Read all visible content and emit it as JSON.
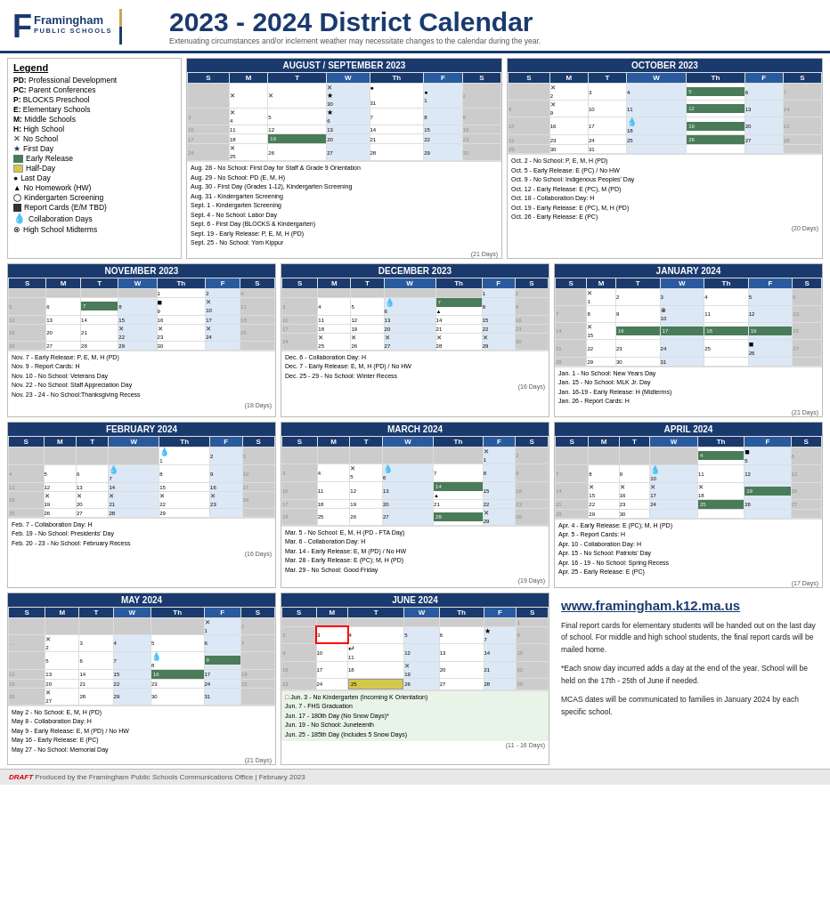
{
  "header": {
    "title": "2023 - 2024 District Calendar",
    "subtitle": "Extenuating circumstances and/or inclement weather may necessitate changes to the calendar during the year.",
    "logo_name": "Framingham",
    "logo_sub": "PUBLIC SCHOOLS"
  },
  "legend": {
    "title": "Legend",
    "items": [
      {
        "symbol": "PD:",
        "text": "Professional Development"
      },
      {
        "symbol": "PC:",
        "text": "Parent Conferences"
      },
      {
        "symbol": "P:",
        "text": "BLOCKS Preschool"
      },
      {
        "symbol": "E:",
        "text": "Elementary Schools"
      },
      {
        "symbol": "M:",
        "text": "Middle Schools"
      },
      {
        "symbol": "H:",
        "text": "High School"
      },
      {
        "symbol": "✕",
        "text": "No School"
      },
      {
        "symbol": "★",
        "text": "First Day"
      },
      {
        "symbol": "■green",
        "text": "Early Release"
      },
      {
        "symbol": "■yellow",
        "text": "Half-Day"
      },
      {
        "symbol": "●",
        "text": "Last Day"
      },
      {
        "symbol": "▲",
        "text": "No Homework (HW)"
      },
      {
        "symbol": "○",
        "text": "Kindergarten Screening"
      },
      {
        "symbol": "■black",
        "text": "Report Cards (E/M TBD)"
      },
      {
        "symbol": "💧",
        "text": "Collaboration Days"
      },
      {
        "symbol": "⊗",
        "text": "High School Midterms"
      }
    ]
  },
  "website": "www.framingham.k12.ma.us",
  "right_text_1": "Final report cards for elementary students will be handed out on the last day of school. For middle and high school students, the final report cards will be mailed home.",
  "right_text_2": "*Each snow day incurred adds a day at the end of the year. School will be held on the 17th - 25th of June if needed.",
  "right_text_3": "MCAS dates will be communicated to families in January 2024 by each specific school.",
  "footer": "Produced by the Framingham Public Schools Communications Office | February 2023",
  "months": {
    "aug_sep": {
      "title": "AUGUST / SEPTEMBER 2023",
      "notes": [
        "Aug. 28 - No School: First Day for Staff & Grade 9 Orientation",
        "Aug. 29 - No School: PD (E, M, H)",
        "Aug. 30 - First Day (Grades 1-12), Kindergarten Screening",
        "Aug. 31 - Kindergarten Screening",
        "Sept. 1 - Kindergarten Screening",
        "Sept. 4 - No School: Labor Day",
        "Sept. 6 - First Day (BLOCKS & Kindergarten)",
        "Sept. 19 - Early Release: P, E, M, H (PD)",
        "Sept. 25 - No School: Yom Kippur"
      ],
      "days": "(21 Days)"
    },
    "october": {
      "title": "OCTOBER 2023",
      "notes": [
        "Oct. 2 - No School: P, E, M, H (PD)",
        "Oct. 5 - Early Release: E (PC) / No HW",
        "Oct. 9 - No School: Indigenous Peoples' Day",
        "Oct. 12 - Early Release: E (PC), M (PD)",
        "Oct. 18 - Collaboration Day: H",
        "Oct. 19 - Early Release: E (PC), M, H (PD)",
        "Oct. 26 - Early Release: E (PC)"
      ],
      "days": "(20 Days)"
    },
    "november": {
      "title": "NOVEMBER 2023",
      "notes": [
        "Nov. 7 - Early Release: P, E, M, H (PD)",
        "Nov. 9 - Report Cards: H",
        "Nov. 10 - No School: Veterans Day",
        "Nov. 22 - No School: Staff Appreciation Day",
        "Nov. 23 - 24 - No School: Thanksgiving Recess"
      ],
      "days": "(18 Days)"
    },
    "december": {
      "title": "DECEMBER 2023",
      "notes": [
        "Dec. 6 - Collaboration Day: H",
        "Dec. 7 - Early Release: E, M, H (PD) / No HW",
        "Dec. 25 - 29 - No School: Winter Recess"
      ],
      "days": "(16 Days)"
    },
    "january": {
      "title": "JANUARY 2024",
      "notes": [
        "Jan. 1 - No School: New Years Day",
        "Jan. 15 - No School: MLK Jr. Day",
        "Jan. 16-19 - Early Release: H (Midterms)",
        "Jan. 26 - Report Cards: H"
      ],
      "days": "(21 Days)"
    },
    "february": {
      "title": "FEBRUARY 2024",
      "notes": [
        "Feb. 7 - Collaboration Day: H",
        "Feb. 19 - No School: Presidents' Day",
        "Feb. 20 - 23 - No School: February Recess"
      ],
      "days": "(16 Days)"
    },
    "march": {
      "title": "MARCH 2024",
      "notes": [
        "Mar. 5 - No School: E, M, H (PD - FTA Day)",
        "Mar. 6 - Collaboration Day: H",
        "Mar. 14 - Early Release: E, M (PD) / No HW",
        "Mar. 28 - Early Release: E (PC); M, H (PD)",
        "Mar. 29 - No School: Good Friday"
      ],
      "days": "(19 Days)"
    },
    "april": {
      "title": "APRIL 2024",
      "notes": [
        "Apr. 4 - Early Release: E (PC); M, H (PD)",
        "Apr. 5 - Report Cards: H",
        "Apr. 10 - Collaboration Day: H",
        "Apr. 15 - No School: Patriots' Day",
        "Apr. 16 - 19 - No School: Spring Recess",
        "Apr. 25 - Early Release: E (PC)"
      ],
      "days": "(17 Days)"
    },
    "may": {
      "title": "MAY 2024",
      "notes": [
        "May 2 - No School: E, M, H (PD)",
        "May 8 - Collaboration Day: H",
        "May 9 - Early Release: E, M (PD) / No HW",
        "May 16 - Early Release: E (PC)",
        "May 27 - No School: Memorial Day"
      ],
      "days": "(21 Days)"
    },
    "june": {
      "title": "JUNE 2024",
      "notes": [
        "Jun. 3 - No Kindergarten (Incoming K Orientation)",
        "Jun. 7 - FHS Graduation",
        "Jun. 17 - 180th Day (No Snow Days)*",
        "Jun. 19 - No School: Juneteenth",
        "Jun. 25 - 185th Day (Includes 5 Snow Days)"
      ],
      "days": "(11 - 16 Days)"
    }
  }
}
